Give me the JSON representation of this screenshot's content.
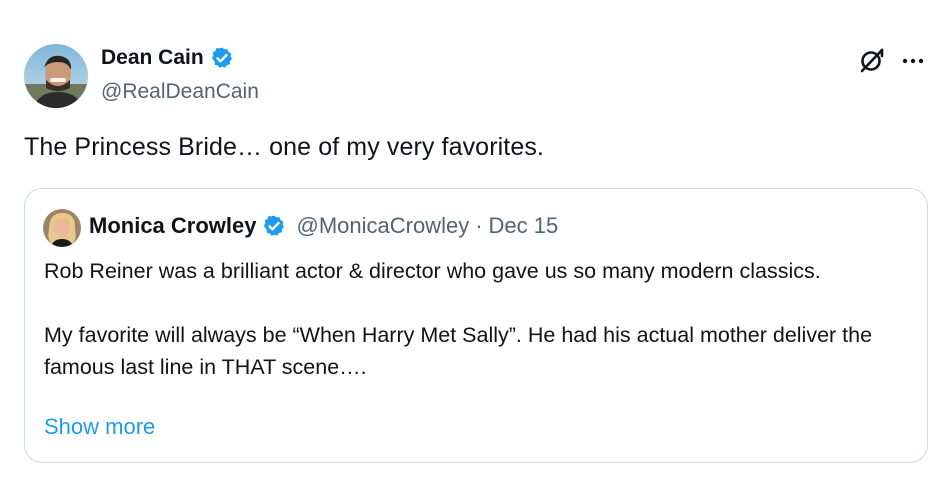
{
  "post": {
    "author": {
      "display_name": "Dean Cain",
      "handle": "@RealDeanCain",
      "verified_icon": "verified-badge-icon",
      "verified_color": "#1d9bf0"
    },
    "text": "The Princess Bride… one of my very favorites.",
    "actions": {
      "grok_icon": "grok-icon",
      "more_icon": "more-dots-icon"
    }
  },
  "quoted_post": {
    "author": {
      "display_name": "Monica Crowley",
      "handle": "@MonicaCrowley",
      "separator": "·",
      "date": "Dec 15"
    },
    "body_lines": [
      "Rob Reiner was a brilliant actor & director who gave us so many modern classics.",
      "My favorite will always be “When Harry Met Sally”.  He had his actual mother deliver the famous last line in THAT scene…."
    ],
    "show_more": "Show more",
    "link_color": "#1d9bf0"
  }
}
